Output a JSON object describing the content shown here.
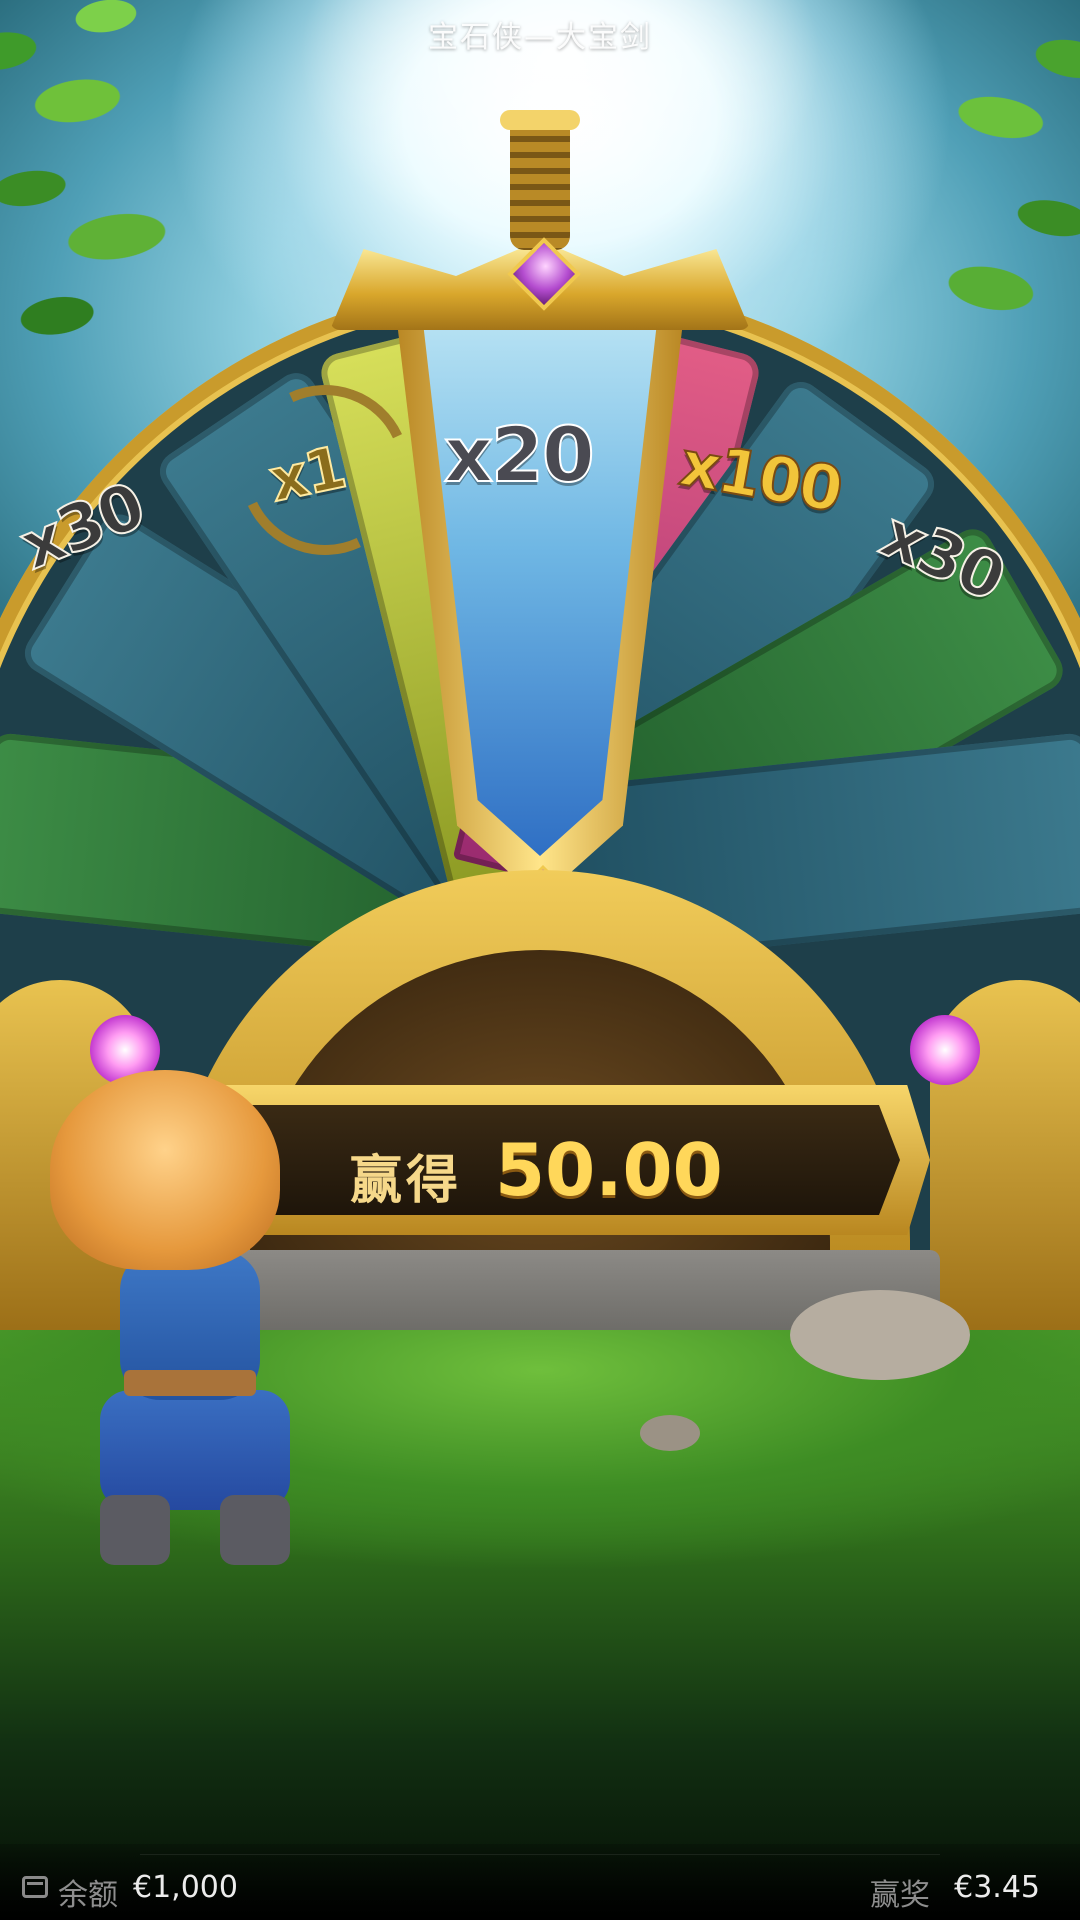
{
  "header": {
    "title": "宝石侠—大宝剑"
  },
  "wheel": {
    "segments": [
      {
        "label": "x30",
        "color": "#2f5f72"
      },
      {
        "label": "x1",
        "color": "#bcc94a"
      },
      {
        "label": "x20",
        "color": "#6fb7e4"
      },
      {
        "label": "x100",
        "color": "#d24b83"
      },
      {
        "label": "x30",
        "color": "#2f5f72"
      }
    ]
  },
  "result": {
    "label": "赢得",
    "amount": "50.00"
  },
  "footer": {
    "balance_label": "余额",
    "balance_value": "€1,000",
    "win_label": "赢奖",
    "win_value": "€3.45"
  },
  "icons": {
    "wallet": "wallet-icon",
    "sword": "sword-icon",
    "gem": "gem-icon"
  }
}
